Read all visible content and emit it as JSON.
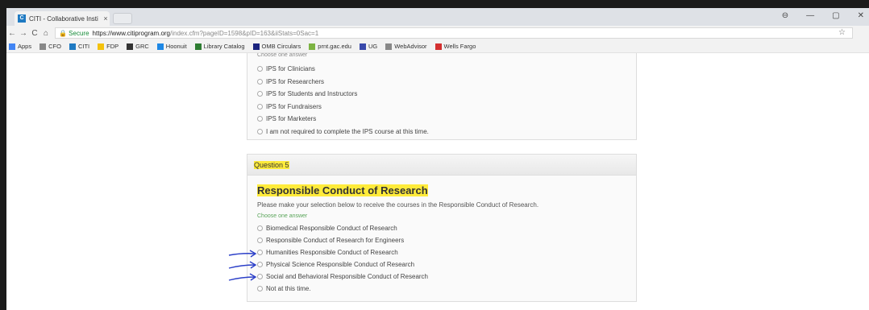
{
  "browser": {
    "tab_title": "CITI - Collaborative Insti",
    "tab_close": "×",
    "window_controls": [
      "⊖",
      "—",
      "▢",
      "✕"
    ],
    "nav": {
      "back": "←",
      "forward": "→",
      "reload": "C",
      "home": "⌂"
    },
    "secure_label": "🔒 Secure",
    "url_host": "https://www.citiprogram.org",
    "url_rest": "/index.cfm?pageID=1598&pID=163&iiStats=0Sac=1",
    "star": "☆",
    "bookmarks": [
      {
        "label": "Apps",
        "color": "#4285f4"
      },
      {
        "label": "CFO",
        "color": "#888888"
      },
      {
        "label": "CITI",
        "color": "#1f7ac2"
      },
      {
        "label": "FDP",
        "color": "#f4c20d"
      },
      {
        "label": "GRC",
        "color": "#333333"
      },
      {
        "label": "Hoonuit",
        "color": "#1e88e5"
      },
      {
        "label": "Library Catalog",
        "color": "#2e7d32"
      },
      {
        "label": "OMB Circulars",
        "color": "#1a237e"
      },
      {
        "label": "prnt.gac.edu",
        "color": "#7cb342"
      },
      {
        "label": "UG",
        "color": "#3949ab"
      },
      {
        "label": "WebAdvisor",
        "color": "#888888"
      },
      {
        "label": "Wells Fargo",
        "color": "#d32f2f"
      }
    ]
  },
  "question4": {
    "choose_label": "Choose one answer",
    "options": [
      "IPS for Clinicians",
      "IPS for Researchers",
      "IPS for Students and Instructors",
      "IPS for Fundraisers",
      "IPS for Marketers",
      "I am not required to complete the IPS course at this time."
    ]
  },
  "question5": {
    "header": "Question 5",
    "title": "Responsible Conduct of Research",
    "description": "Please make your selection below to receive the courses in the Responsible Conduct of Research.",
    "choose_label": "Choose one answer",
    "options": [
      "Biomedical Responsible Conduct of Research",
      "Responsible Conduct of Research for Engineers",
      "Humanities Responsible Conduct of Research",
      "Physical Science Responsible Conduct of Research",
      "Social and Behavioral Responsible Conduct of Research",
      "Not at this time."
    ]
  },
  "colors": {
    "highlight": "#ffeb3b",
    "arrow": "#2b3fc8",
    "accent_green": "#5aa55a"
  }
}
